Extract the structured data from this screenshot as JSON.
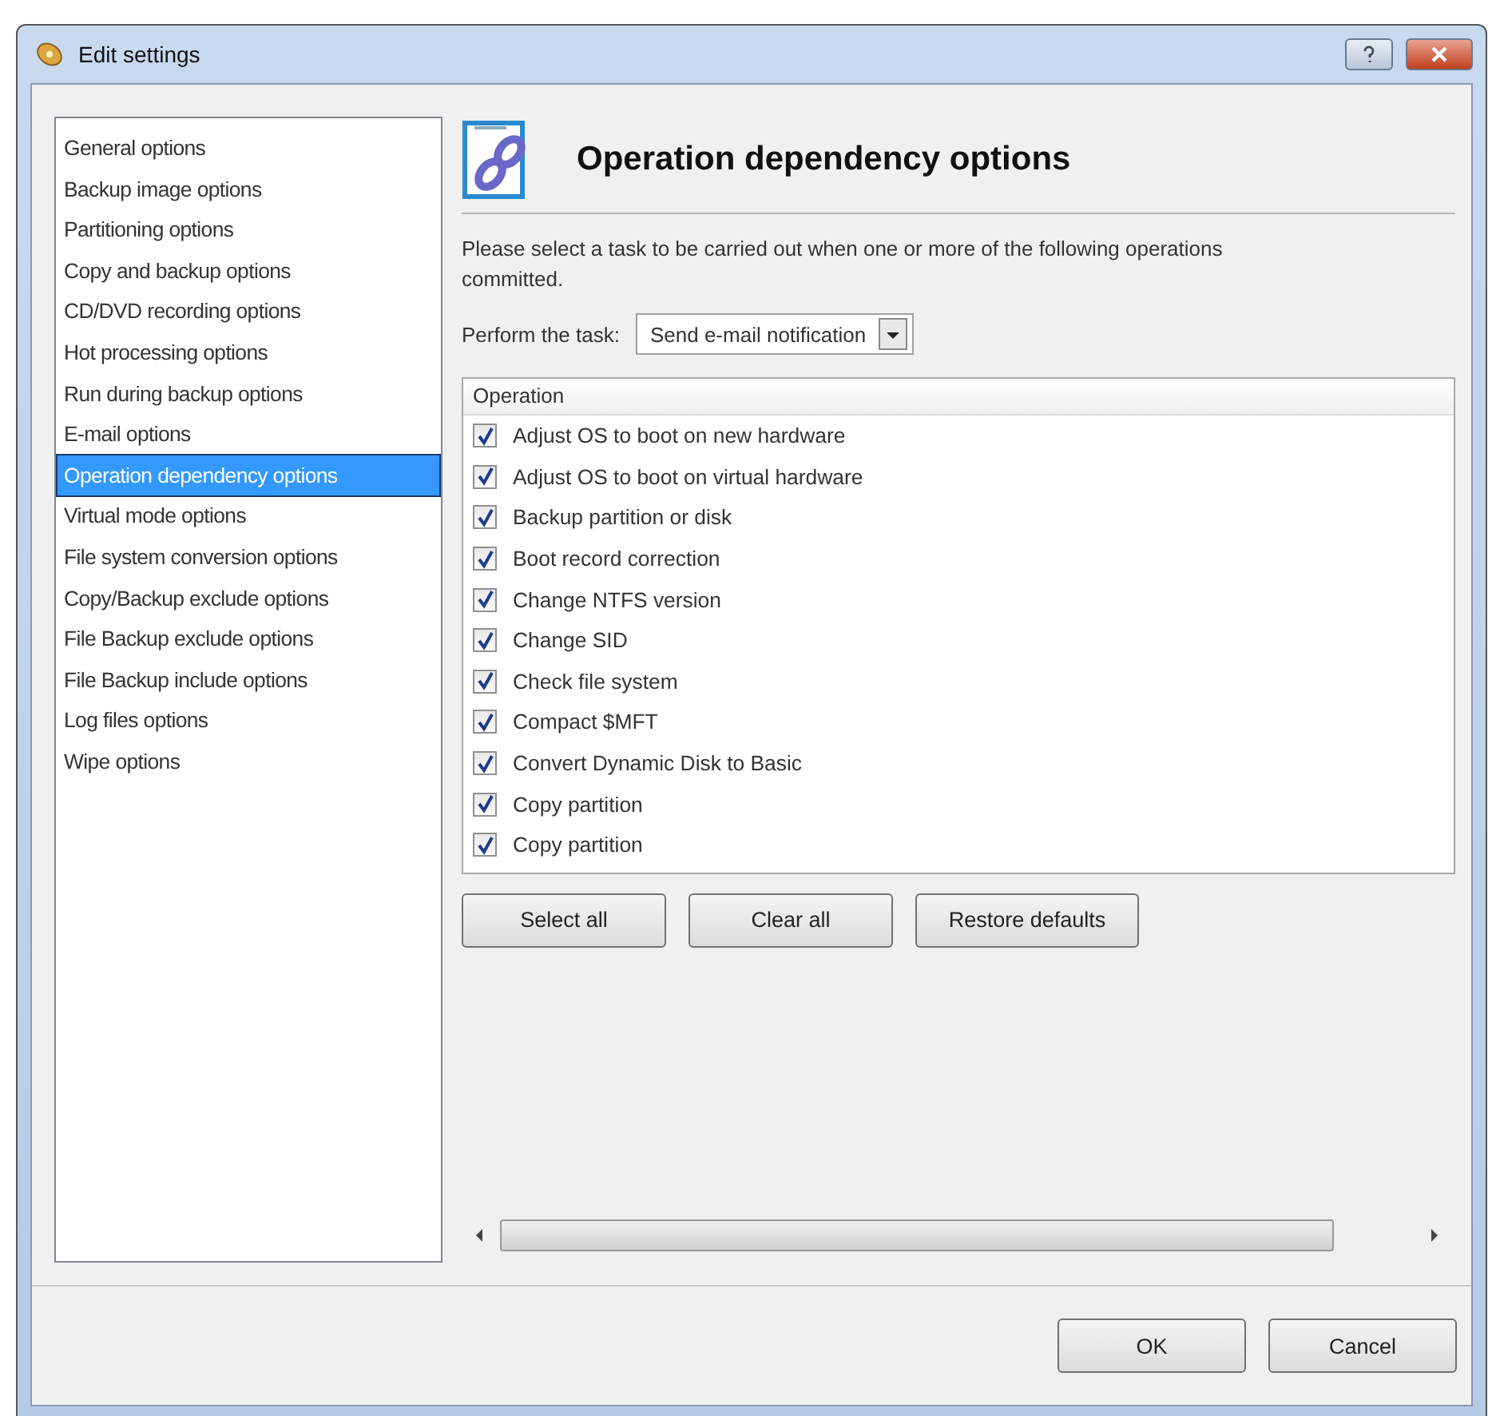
{
  "window": {
    "title": "Edit settings"
  },
  "sidebar": {
    "items": [
      {
        "label": "General options",
        "selected": false
      },
      {
        "label": "Backup image options",
        "selected": false
      },
      {
        "label": "Partitioning options",
        "selected": false
      },
      {
        "label": "Copy and backup options",
        "selected": false
      },
      {
        "label": "CD/DVD recording options",
        "selected": false
      },
      {
        "label": "Hot processing options",
        "selected": false
      },
      {
        "label": "Run during backup options",
        "selected": false
      },
      {
        "label": "E-mail options",
        "selected": false
      },
      {
        "label": "Operation dependency options",
        "selected": true
      },
      {
        "label": "Virtual mode options",
        "selected": false
      },
      {
        "label": "File system conversion options",
        "selected": false
      },
      {
        "label": "Copy/Backup exclude options",
        "selected": false
      },
      {
        "label": "File Backup exclude options",
        "selected": false
      },
      {
        "label": "File Backup include options",
        "selected": false
      },
      {
        "label": "Log files options",
        "selected": false
      },
      {
        "label": "Wipe options",
        "selected": false
      }
    ]
  },
  "panel": {
    "heading": "Operation dependency options",
    "description_lines": [
      "Please select a task to be carried out when one or more of the following operations",
      "committed."
    ],
    "task_label": "Perform the task:",
    "task_value": "Send e-mail notification",
    "table": {
      "columns": [
        "Operation"
      ],
      "rows": [
        {
          "label": "Adjust OS to boot on new hardware",
          "checked": true
        },
        {
          "label": "Adjust OS to boot on virtual hardware",
          "checked": true
        },
        {
          "label": "Backup partition or disk",
          "checked": true
        },
        {
          "label": "Boot record correction",
          "checked": true
        },
        {
          "label": "Change NTFS version",
          "checked": true
        },
        {
          "label": "Change SID",
          "checked": true
        },
        {
          "label": "Check file system",
          "checked": true
        },
        {
          "label": "Compact $MFT",
          "checked": true
        },
        {
          "label": "Convert Dynamic Disk to Basic",
          "checked": true
        },
        {
          "label": "Copy partition",
          "checked": true
        },
        {
          "label": "Copy partition",
          "checked": true
        }
      ]
    },
    "buttons": [
      "Select all",
      "Clear all",
      "Restore defaults"
    ]
  },
  "footer_buttons": [
    "OK",
    "Cancel"
  ]
}
